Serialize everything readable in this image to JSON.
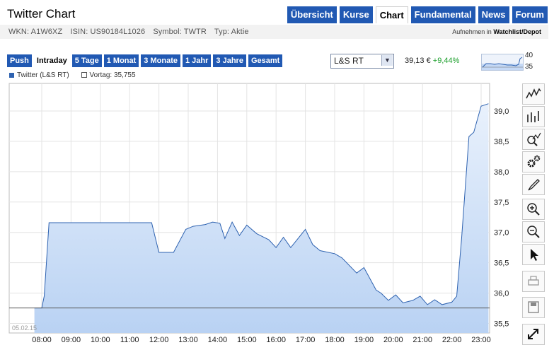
{
  "header": {
    "title": "Twitter Chart",
    "nav": [
      "Übersicht",
      "Kurse",
      "Chart",
      "Fundamental",
      "News",
      "Forum"
    ],
    "active_nav": "Chart",
    "wkn": "WKN: A1W6XZ",
    "isin": "ISIN: US90184L1026",
    "symbol": "Symbol: TWTR",
    "typ": "Typ: Aktie",
    "add_prefix": "Aufnehmen in",
    "add_link": "Watchlist/Depot"
  },
  "timeframes": [
    "Push",
    "Intraday",
    "5 Tage",
    "1 Monat",
    "3 Monate",
    "1 Jahr",
    "3 Jahre",
    "Gesamt"
  ],
  "active_timeframe": "Intraday",
  "exchange_select": "L&S RT",
  "quote": {
    "price": "39,13 €",
    "change": "+9,44%"
  },
  "mini_chart": {
    "high": "40",
    "low": "35"
  },
  "legend": {
    "series": "Twitter (L&S RT)",
    "prev": "Vortag: 35,755"
  },
  "date_label": "05.02.15",
  "toolbar": [
    "line-chart-icon",
    "ohlc-chart-icon",
    "indicator-icon",
    "settings-icon",
    "draw-icon",
    "zoom-in-icon",
    "zoom-out-icon",
    "pointer-icon",
    "print-icon",
    "save-icon",
    "expand-icon"
  ],
  "colors": {
    "nav": "#2159b3",
    "series": "#2e62b0",
    "fill": "#c5d9f6",
    "up": "#1a9e2a"
  },
  "chart_data": {
    "type": "area",
    "x_ticks": [
      "08:00",
      "09:00",
      "10:00",
      "11:00",
      "12:00",
      "13:00",
      "14:00",
      "15:00",
      "16:00",
      "17:00",
      "18:00",
      "19:00",
      "20:00",
      "21:00",
      "22:00",
      "23:00"
    ],
    "y_ticks": [
      "35,5",
      "36,0",
      "36,5",
      "37,0",
      "37,5",
      "38,0",
      "38,5",
      "39,0"
    ],
    "ylim": [
      35.5,
      39.0
    ],
    "reference_line": 35.755,
    "series": [
      {
        "name": "Twitter (L&S RT)",
        "points": [
          [
            "07:45",
            35.755
          ],
          [
            "08:00",
            35.755
          ],
          [
            "08:05",
            35.95
          ],
          [
            "08:15",
            37.16
          ],
          [
            "09:00",
            37.16
          ],
          [
            "10:00",
            37.16
          ],
          [
            "11:00",
            37.16
          ],
          [
            "11:45",
            37.16
          ],
          [
            "12:00",
            36.67
          ],
          [
            "12:30",
            36.67
          ],
          [
            "12:55",
            37.05
          ],
          [
            "13:10",
            37.1
          ],
          [
            "13:35",
            37.13
          ],
          [
            "13:50",
            37.17
          ],
          [
            "14:05",
            37.15
          ],
          [
            "14:15",
            36.9
          ],
          [
            "14:30",
            37.17
          ],
          [
            "14:45",
            36.95
          ],
          [
            "15:00",
            37.12
          ],
          [
            "15:20",
            36.98
          ],
          [
            "15:45",
            36.88
          ],
          [
            "16:00",
            36.75
          ],
          [
            "16:15",
            36.92
          ],
          [
            "16:30",
            36.75
          ],
          [
            "17:00",
            37.05
          ],
          [
            "17:15",
            36.8
          ],
          [
            "17:30",
            36.7
          ],
          [
            "18:00",
            36.65
          ],
          [
            "18:15",
            36.58
          ],
          [
            "18:45",
            36.33
          ],
          [
            "19:00",
            36.42
          ],
          [
            "19:25",
            36.05
          ],
          [
            "19:35",
            36.0
          ],
          [
            "19:50",
            35.88
          ],
          [
            "20:05",
            35.97
          ],
          [
            "20:20",
            35.84
          ],
          [
            "20:40",
            35.88
          ],
          [
            "20:55",
            35.95
          ],
          [
            "21:10",
            35.81
          ],
          [
            "21:25",
            35.89
          ],
          [
            "21:40",
            35.81
          ],
          [
            "22:00",
            35.85
          ],
          [
            "22:10",
            35.95
          ],
          [
            "22:20",
            36.9
          ],
          [
            "22:35",
            38.58
          ],
          [
            "22:45",
            38.65
          ],
          [
            "23:00",
            39.08
          ],
          [
            "23:15",
            39.12
          ]
        ]
      }
    ]
  }
}
